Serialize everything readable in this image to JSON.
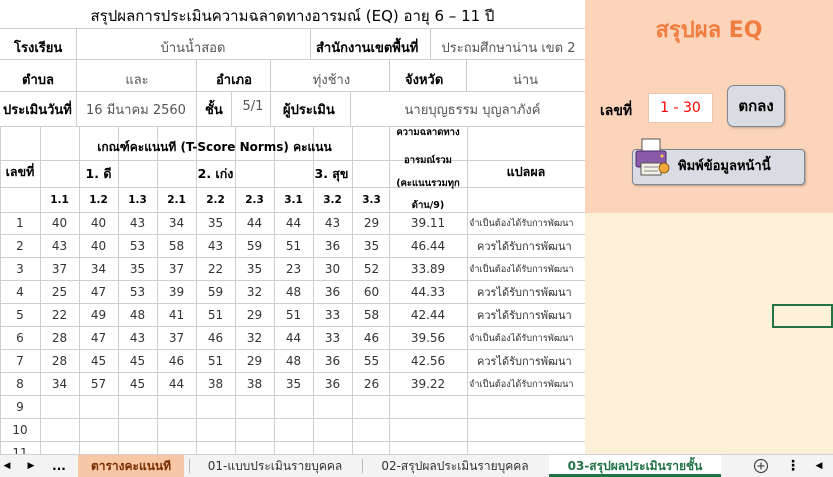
{
  "sheet": {
    "title": "สรุปผลการประเมินความฉลาดทางอารมณ์ (EQ) อายุ 6 – 11 ปี",
    "school_label": "โรงเรียน",
    "school_value": "บ้านน้ำสอด",
    "office_label": "สำนักงานเขตพื้นที่",
    "office_value": "ประถมศึกษาน่าน เขต 2",
    "subdistrict_label": "ตำบล",
    "subdistrict_value": "และ",
    "district_label": "อำเภอ",
    "district_value": "ทุ่งช้าง",
    "province_label": "จังหวัด",
    "province_value": "น่าน",
    "date_label": "ประเมินวันที่",
    "date_value": "16 มีนาคม 2560",
    "class_label": "ชั้น",
    "class_value": "5/1",
    "assessor_label": "ผู้ประเมิน",
    "assessor_value": "นายบุญธรรม  บุญลาภังค์"
  },
  "table": {
    "col_no": "เลขที่",
    "criteria_header": "เกณฑ์คะแนนที (T-Score Norms) คะแนน",
    "group1": "1. ดี",
    "group2": "2. เก่ง",
    "group3": "3. สุข",
    "sub_headers": [
      "1.1",
      "1.2",
      "1.3",
      "2.1",
      "2.2",
      "2.3",
      "3.1",
      "3.2",
      "3.3"
    ],
    "total_header_1": "ความฉลาดทาง",
    "total_header_2": "อารมณ์รวม",
    "total_header_3": "(คะแนนรวมทุก",
    "total_header_4": "ด้าน/9)",
    "interp_header": "แปลผล",
    "rows": [
      {
        "no": "1",
        "s": [
          "40",
          "40",
          "43",
          "34",
          "35",
          "44",
          "44",
          "43",
          "29"
        ],
        "total": "39.11",
        "result": "จำเป็นต้องได้รับการพัฒนา"
      },
      {
        "no": "2",
        "s": [
          "43",
          "40",
          "53",
          "58",
          "43",
          "59",
          "51",
          "36",
          "35"
        ],
        "total": "46.44",
        "result": "ควรได้รับการพัฒนา"
      },
      {
        "no": "3",
        "s": [
          "37",
          "34",
          "35",
          "37",
          "22",
          "35",
          "23",
          "30",
          "52"
        ],
        "total": "33.89",
        "result": "จำเป็นต้องได้รับการพัฒนา"
      },
      {
        "no": "4",
        "s": [
          "25",
          "47",
          "53",
          "39",
          "59",
          "32",
          "48",
          "36",
          "60"
        ],
        "total": "44.33",
        "result": "ควรได้รับการพัฒนา"
      },
      {
        "no": "5",
        "s": [
          "22",
          "49",
          "48",
          "41",
          "51",
          "29",
          "51",
          "33",
          "58"
        ],
        "total": "42.44",
        "result": "ควรได้รับการพัฒนา"
      },
      {
        "no": "6",
        "s": [
          "28",
          "47",
          "43",
          "37",
          "46",
          "32",
          "44",
          "33",
          "46"
        ],
        "total": "39.56",
        "result": "จำเป็นต้องได้รับการพัฒนา"
      },
      {
        "no": "7",
        "s": [
          "28",
          "45",
          "45",
          "46",
          "51",
          "29",
          "48",
          "36",
          "55"
        ],
        "total": "42.56",
        "result": "ควรได้รับการพัฒนา"
      },
      {
        "no": "8",
        "s": [
          "34",
          "57",
          "45",
          "44",
          "38",
          "38",
          "35",
          "36",
          "26"
        ],
        "total": "39.22",
        "result": "จำเป็นต้องได้รับการพัฒนา"
      },
      {
        "no": "9",
        "s": [
          "",
          "",
          "",
          "",
          "",
          "",
          "",
          "",
          ""
        ],
        "total": "",
        "result": ""
      },
      {
        "no": "10",
        "s": [
          "",
          "",
          "",
          "",
          "",
          "",
          "",
          "",
          ""
        ],
        "total": "",
        "result": ""
      },
      {
        "no": "11",
        "s": [
          "",
          "",
          "",
          "",
          "",
          "",
          "",
          "",
          ""
        ],
        "total": "",
        "result": ""
      }
    ]
  },
  "panel": {
    "title": "สรุปผล EQ",
    "seq_label": "เลขที่",
    "range": "1 - 30",
    "ok_label": "ตกลง",
    "print_label": "พิมพ์ข้อมูลหน้านี้",
    "print_icon": "printer-icon"
  },
  "tabs": {
    "more": "...",
    "items": [
      "ตารางคะแนนที",
      "01-แบบประเมินรายบุคคล",
      "02-สรุปผลประเมินรายบุคคล",
      "03-สรุปผลประเมินรายชั้น"
    ],
    "active_index": 3,
    "add_icon": "plus-circle-icon",
    "menu_icon": "vertical-dots-icon"
  },
  "colors": {
    "panel_header": "#fbd4b9",
    "panel_body": "#fdf0d9",
    "panel_title": "#f07d3f",
    "range_text": "#ff0000",
    "active_tab": "#217346",
    "score_tab": "#f8c7a6"
  }
}
